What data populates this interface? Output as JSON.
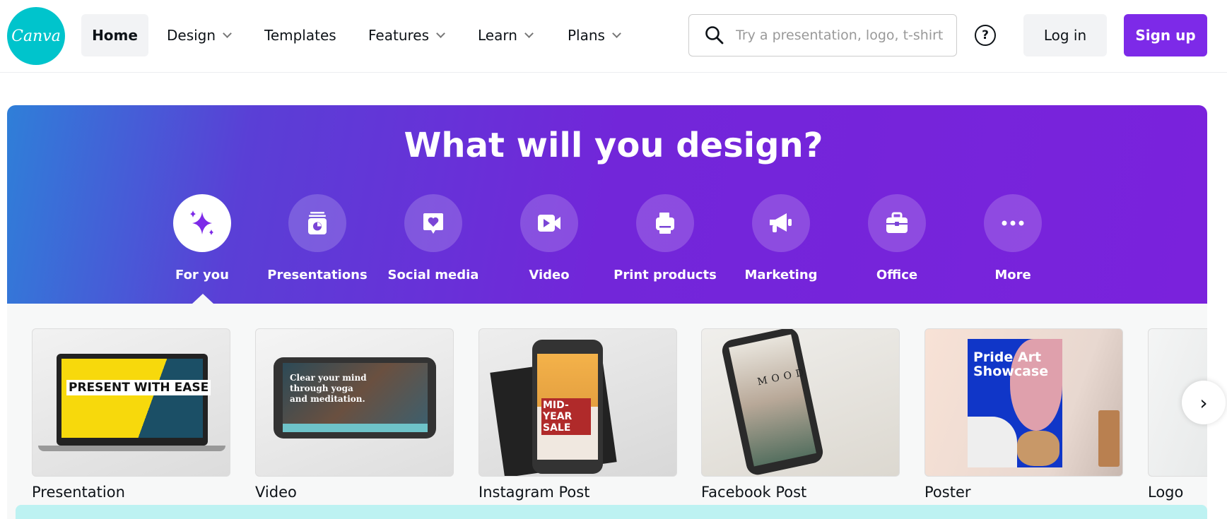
{
  "header": {
    "logo_text": "Canva",
    "nav": [
      {
        "label": "Home",
        "active": true
      },
      {
        "label": "Design",
        "dropdown": true
      },
      {
        "label": "Templates"
      },
      {
        "label": "Features",
        "dropdown": true
      },
      {
        "label": "Learn",
        "dropdown": true
      },
      {
        "label": "Plans",
        "dropdown": true
      }
    ],
    "search_placeholder": "Try a presentation, logo, t-shirt",
    "help_icon": "?",
    "login_label": "Log in",
    "signup_label": "Sign up"
  },
  "colors": {
    "brand_teal": "#00c4cc",
    "accent_purple": "#7d2ae8",
    "banner_start": "#2f7fd8",
    "banner_end": "#7a22dc"
  },
  "hero": {
    "title": "What will you design?",
    "categories": [
      {
        "label": "For you",
        "icon": "sparkle-icon",
        "selected": true
      },
      {
        "label": "Presentations",
        "icon": "presentation-icon"
      },
      {
        "label": "Social media",
        "icon": "heart-bubble-icon"
      },
      {
        "label": "Video",
        "icon": "video-camera-icon"
      },
      {
        "label": "Print products",
        "icon": "printer-icon"
      },
      {
        "label": "Marketing",
        "icon": "megaphone-icon"
      },
      {
        "label": "Office",
        "icon": "briefcase-icon"
      },
      {
        "label": "More",
        "icon": "more-dots-icon"
      }
    ]
  },
  "designs": [
    {
      "label": "Presentation",
      "thumb_text": "PRESENT WITH EASE"
    },
    {
      "label": "Video",
      "thumb_text": "Clear your mind through yoga and meditation."
    },
    {
      "label": "Instagram Post",
      "thumb_text": "MID-YEAR SALE"
    },
    {
      "label": "Facebook Post",
      "thumb_text": "MOOD"
    },
    {
      "label": "Poster",
      "thumb_text": "Pride Art Showcase"
    },
    {
      "label": "Logo",
      "thumb_text": ""
    }
  ],
  "next_icon": "›"
}
